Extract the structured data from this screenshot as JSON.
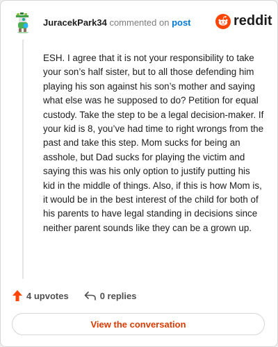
{
  "header": {
    "username": "JuracekPark34",
    "action_text": "commented on",
    "post_link": "post",
    "brand": "reddit"
  },
  "comment": {
    "body": "ESH. I agree that it is not your responsibility to take your son’s half sister, but to all those defending him playing his son against his son’s mother and saying what else was he supposed to do? Petition for equal custody. Take the step to be a legal decision-maker. If your kid is 8, you’ve had time to right wrongs from the past and take this step. Mom sucks for being an asshole, but Dad sucks for playing the victim and saying this was his only option to justify putting his kid in the middle of things. Also, if this is how Mom is, it would be in the best interest of the child for both of his parents to have legal standing in decisions since neither parent sounds like they can be a grown up."
  },
  "actions": {
    "upvotes": "4 upvotes",
    "replies": "0 replies"
  },
  "footer": {
    "view_button": "View the conversation"
  },
  "colors": {
    "brand_orange": "#ff4500",
    "link_blue": "#0079d3",
    "button_text": "#d93a00"
  }
}
